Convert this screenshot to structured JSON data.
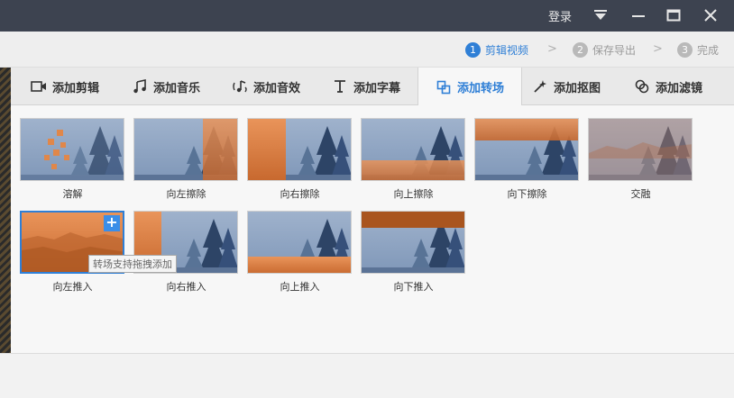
{
  "titlebar": {
    "login": "登录"
  },
  "steps": [
    {
      "num": "1",
      "label": "剪辑视频"
    },
    {
      "num": "2",
      "label": "保存导出"
    },
    {
      "num": "3",
      "label": "完成"
    }
  ],
  "step_arrow": ">",
  "tabs": [
    {
      "label": "添加剪辑",
      "icon": "video-camera-icon"
    },
    {
      "label": "添加音乐",
      "icon": "music-note-icon"
    },
    {
      "label": "添加音效",
      "icon": "sound-effect-icon"
    },
    {
      "label": "添加字幕",
      "icon": "text-t-icon"
    },
    {
      "label": "添加转场",
      "icon": "transition-icon"
    },
    {
      "label": "添加抠图",
      "icon": "magic-wand-icon"
    },
    {
      "label": "添加滤镜",
      "icon": "filter-icon"
    }
  ],
  "transitions": [
    {
      "label": "溶解"
    },
    {
      "label": "向左擦除"
    },
    {
      "label": "向右擦除"
    },
    {
      "label": "向上擦除"
    },
    {
      "label": "向下擦除"
    },
    {
      "label": "交融"
    },
    {
      "label": "向左推入"
    },
    {
      "label": "向右推入"
    },
    {
      "label": "向上推入"
    },
    {
      "label": "向下推入"
    }
  ],
  "add_symbol": "+",
  "tooltip": "转场支持拖拽添加",
  "colors": {
    "accent": "#2f7fd6",
    "titlebar": "#3d4350",
    "orange": "#e0874a"
  }
}
